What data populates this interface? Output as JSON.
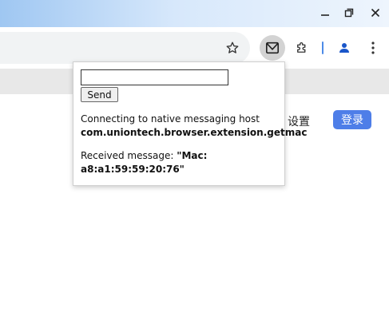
{
  "window": {
    "controls": [
      {
        "name": "minimize",
        "glyph": "—"
      },
      {
        "name": "restore",
        "glyph": "❐"
      },
      {
        "name": "close",
        "glyph": "✕"
      }
    ]
  },
  "toolbar": {
    "icons": [
      "star-icon",
      "extension-mail-icon",
      "puzzle-icon",
      "profile-icon",
      "menu-icon"
    ]
  },
  "page": {
    "settings_label": "设置",
    "login_label": "登录",
    "login_color": "#4e7ee8"
  },
  "popup": {
    "input_value": "",
    "send_label": "Send",
    "connecting_text": "Connecting to native messaging host",
    "host_name": "com.uniontech.browser.extension.getmac",
    "received_prefix": "Received message: ",
    "received_value": "\"Mac: a8:a1:59:59:20:76\""
  }
}
